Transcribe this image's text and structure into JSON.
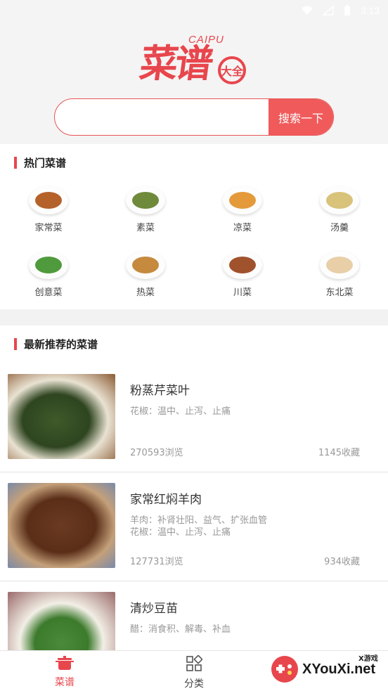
{
  "status_bar": {
    "time": "3:13"
  },
  "logo": {
    "cn": "菜谱",
    "en": "CAIPU",
    "badge": "大全"
  },
  "search": {
    "placeholder": "",
    "button_label": "搜索一下"
  },
  "hot": {
    "title": "热门菜谱",
    "items": [
      {
        "label": "家常菜",
        "color": "#b5612a"
      },
      {
        "label": "素菜",
        "color": "#6e8a3a"
      },
      {
        "label": "凉菜",
        "color": "#e49a3a"
      },
      {
        "label": "汤羹",
        "color": "#d9c27a"
      },
      {
        "label": "创意菜",
        "color": "#4f9a3c"
      },
      {
        "label": "热菜",
        "color": "#c58a3e"
      },
      {
        "label": "川菜",
        "color": "#a0522d"
      },
      {
        "label": "东北菜",
        "color": "#e8cfa8"
      }
    ]
  },
  "recommend": {
    "title": "最新推荐的菜谱",
    "items": [
      {
        "name": "粉蒸芹菜叶",
        "desc": "花椒：温中、止泻、止痛",
        "views": "270593浏览",
        "favorites": "1145收藏",
        "color": "#3f5a2a"
      },
      {
        "name": "家常红焖羊肉",
        "desc": "羊肉：补肾壮阳、益气、扩张血管\n花椒：温中、止泻、止痛",
        "views": "127731浏览",
        "favorites": "934收藏",
        "color": "#6b3a22"
      },
      {
        "name": "清炒豆苗",
        "desc": "醋：消食积、解毒、补血",
        "views": "",
        "favorites": "",
        "color": "#4a8a3a"
      }
    ]
  },
  "bottom_nav": [
    {
      "label": "菜谱",
      "icon": "pot-icon",
      "active": true,
      "color": "#e8464d"
    },
    {
      "label": "分类",
      "icon": "grid-category-icon",
      "active": false,
      "color": "#444444"
    }
  ],
  "watermark": {
    "text": "XYouXi.net",
    "small": "X游戏"
  }
}
